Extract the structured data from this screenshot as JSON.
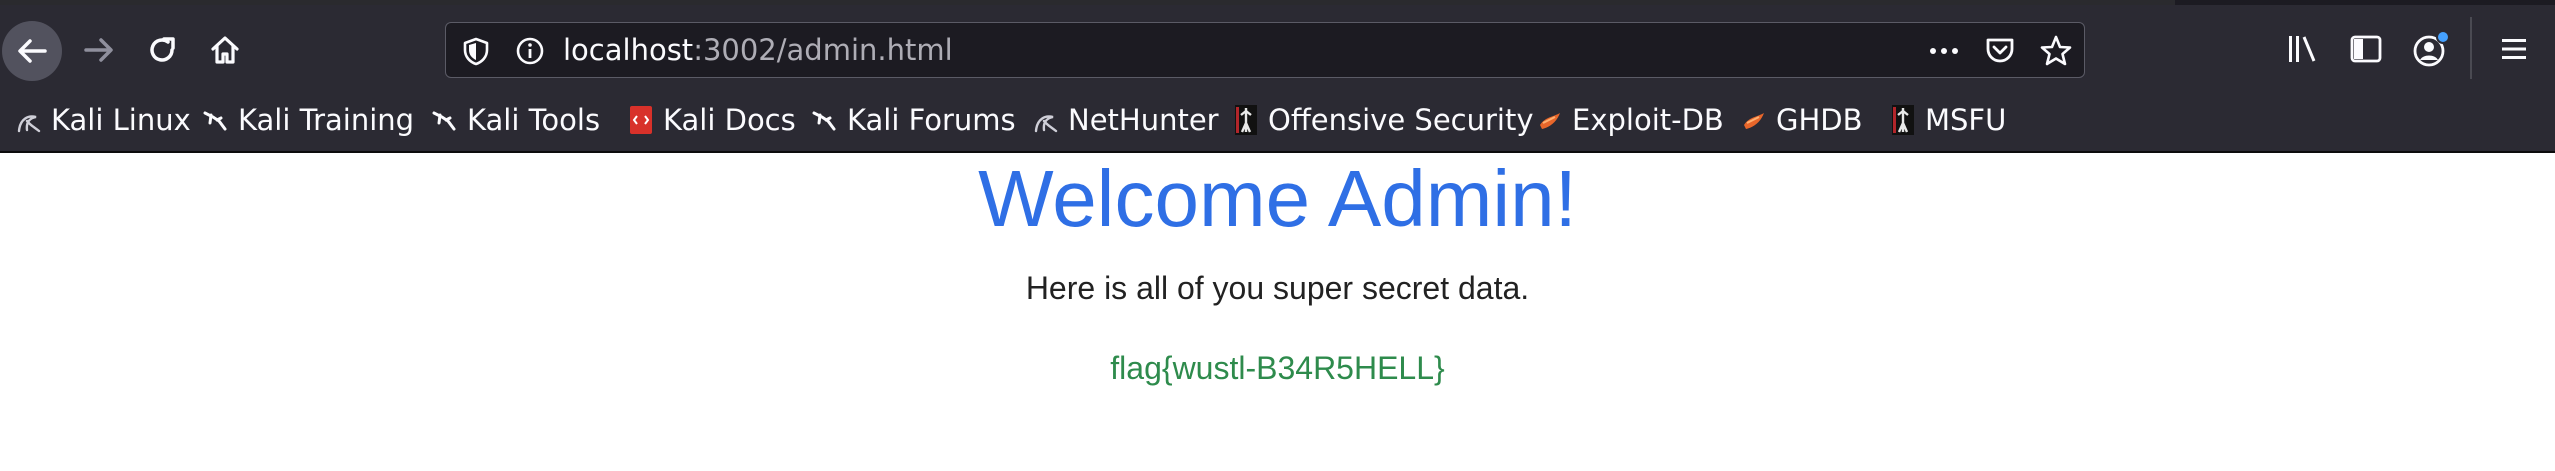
{
  "browser": {
    "url_host": "localhost",
    "url_rest": ":3002/admin.html",
    "icons": [
      "back-icon",
      "forward-icon",
      "reload-icon",
      "home-icon",
      "shield-icon",
      "info-icon",
      "more-icon",
      "pocket-icon",
      "star-icon",
      "library-icon",
      "sidebar-icon",
      "account-icon",
      "menu-icon"
    ]
  },
  "bookmarks": [
    {
      "label": "Kali Linux",
      "icon": "kali-icon"
    },
    {
      "label": "Kali Training",
      "icon": "kali-dragon-icon"
    },
    {
      "label": "Kali Tools",
      "icon": "kali-dragon-icon"
    },
    {
      "label": "Kali Docs",
      "icon": "docs-icon"
    },
    {
      "label": "Kali Forums",
      "icon": "kali-dragon-icon"
    },
    {
      "label": "NetHunter",
      "icon": "kali-icon"
    },
    {
      "label": "Offensive Security",
      "icon": "offsec-icon"
    },
    {
      "label": "Exploit-DB",
      "icon": "exploitdb-icon"
    },
    {
      "label": "GHDB",
      "icon": "exploitdb-icon"
    },
    {
      "label": "MSFU",
      "icon": "offsec-icon"
    }
  ],
  "page": {
    "title": "Welcome Admin!",
    "subtitle": "Here is all of you super secret data.",
    "flag": "flag{wustl-B34R5HELL}"
  },
  "colors": {
    "title": "#2f6fe5",
    "flag": "#2e8b4c",
    "chrome": "#2b2a33"
  }
}
